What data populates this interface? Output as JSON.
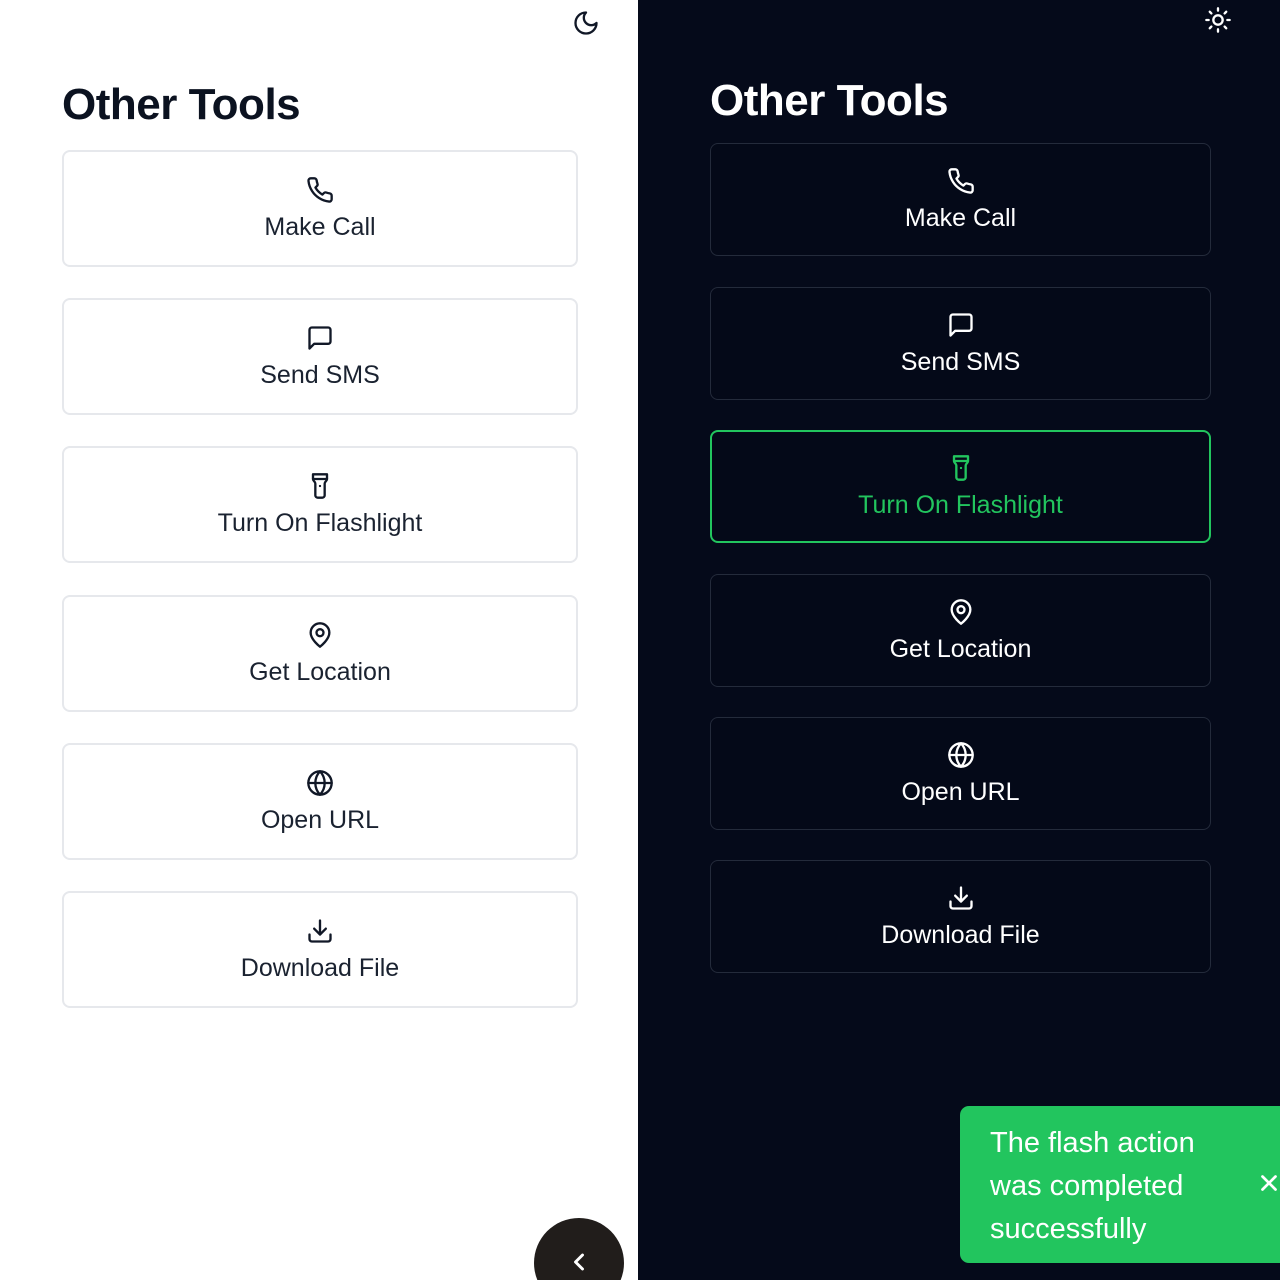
{
  "light": {
    "title": "Other Tools",
    "theme_toggle_icon": "moon-icon",
    "tools": [
      {
        "label": "Make Call",
        "icon": "phone-icon"
      },
      {
        "label": "Send SMS",
        "icon": "message-icon"
      },
      {
        "label": "Turn On Flashlight",
        "icon": "flashlight-icon"
      },
      {
        "label": "Get Location",
        "icon": "map-pin-icon"
      },
      {
        "label": "Open URL",
        "icon": "globe-icon"
      },
      {
        "label": "Download File",
        "icon": "download-icon"
      }
    ],
    "back_button_icon": "chevron-left-icon"
  },
  "dark": {
    "title": "Other Tools",
    "theme_toggle_icon": "sun-icon",
    "active_tool": "Turn On Flashlight",
    "tools": [
      {
        "label": "Make Call",
        "icon": "phone-icon"
      },
      {
        "label": "Send SMS",
        "icon": "message-icon"
      },
      {
        "label": "Turn On Flashlight",
        "icon": "flashlight-icon"
      },
      {
        "label": "Get Location",
        "icon": "map-pin-icon"
      },
      {
        "label": "Open URL",
        "icon": "globe-icon"
      },
      {
        "label": "Download File",
        "icon": "download-icon"
      }
    ],
    "toast": {
      "message": "The flash action was completed successfully",
      "close_icon": "close-icon"
    }
  },
  "colors": {
    "accent": "#22c55e",
    "dark_bg": "#050a1a",
    "light_bg": "#ffffff",
    "light_text": "#0b1220",
    "card_border_light": "#e6e8ec",
    "card_border_dark": "#242b3b",
    "back_button_bg": "#211d1b"
  }
}
